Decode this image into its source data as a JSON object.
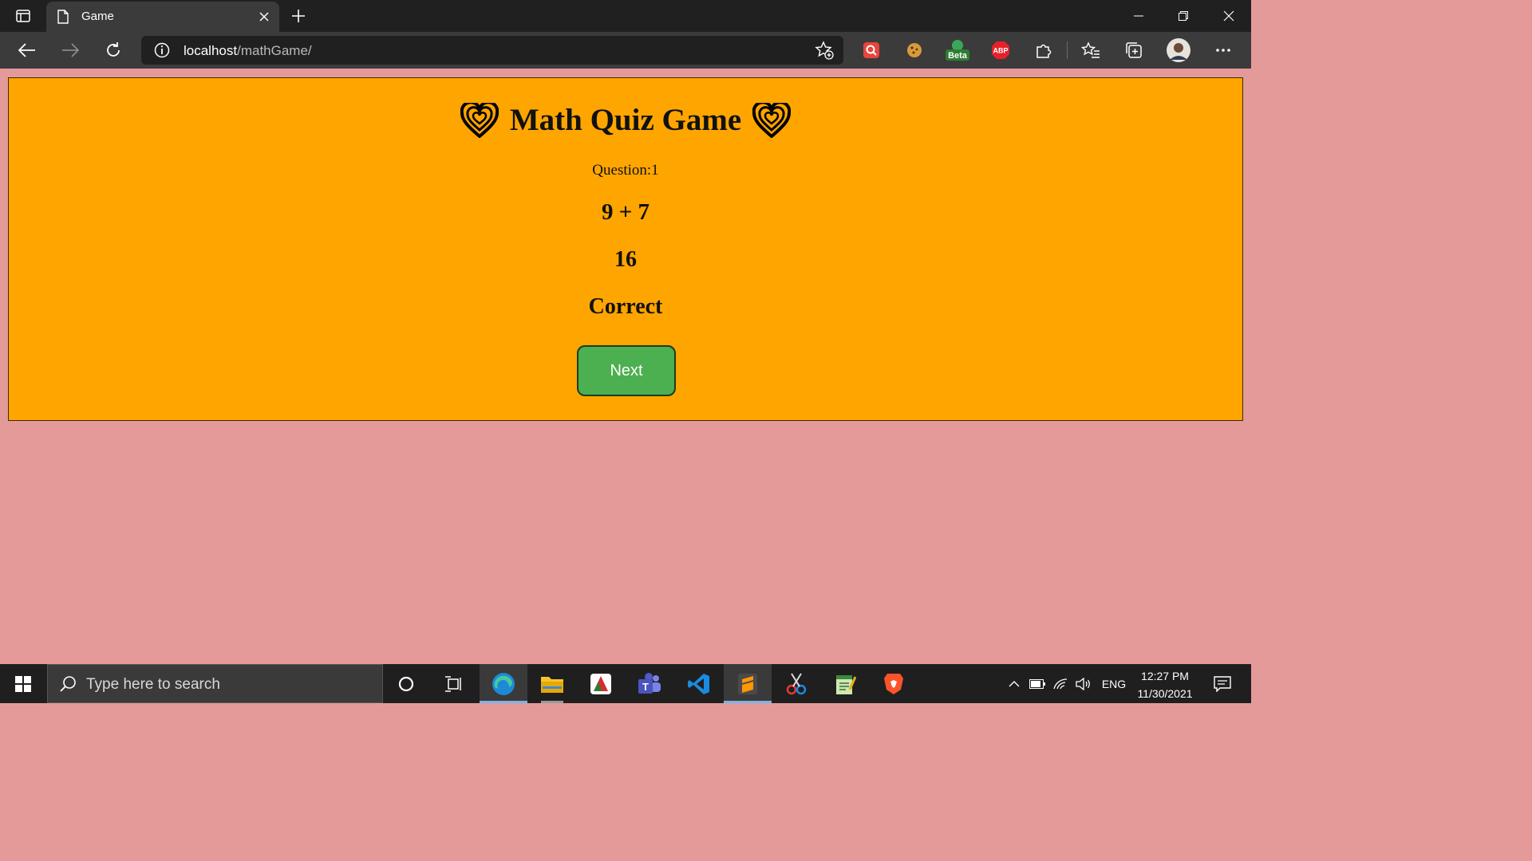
{
  "browser": {
    "tab_title": "Game",
    "address_host": "localhost",
    "address_path": "/mathGame/",
    "extensions": [
      {
        "name": "screenshot-extension-icon",
        "label": ""
      },
      {
        "name": "cookie-extension-icon",
        "label": ""
      },
      {
        "name": "beta-extension-icon",
        "label": "Beta"
      },
      {
        "name": "adblock-plus-icon",
        "label": "ABP"
      },
      {
        "name": "extensions-puzzle-icon",
        "label": ""
      }
    ]
  },
  "game": {
    "title": "Math Quiz Game",
    "question_label": "Question:1",
    "expression": "9 + 7",
    "answer": "16",
    "feedback": "Correct",
    "next_label": "Next",
    "colors": {
      "card_bg": "#ffa500",
      "page_bg": "#e59a9a",
      "button_bg": "#4caf50"
    }
  },
  "taskbar": {
    "search_placeholder": "Type here to search",
    "apps": [
      "cortana-icon",
      "task-view-icon",
      "edge-icon",
      "file-explorer-icon",
      "app-icon",
      "teams-icon",
      "vscode-icon",
      "sublime-text-icon",
      "snipping-tool-icon",
      "notepad-app-icon",
      "brave-icon"
    ],
    "language": "ENG",
    "time": "12:27 PM",
    "date": "11/30/2021"
  }
}
